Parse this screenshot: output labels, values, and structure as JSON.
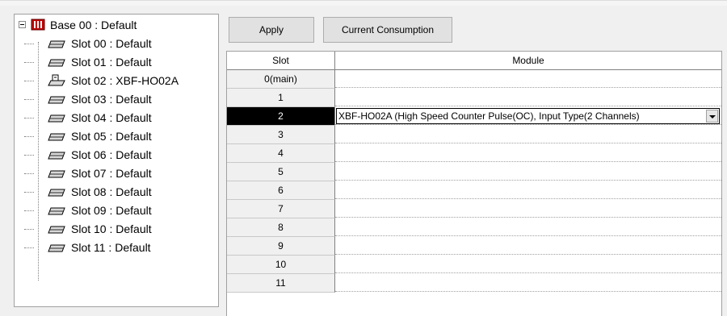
{
  "tree": {
    "base_label": "Base 00 : Default",
    "slots": [
      {
        "label": "Slot 00 : Default",
        "icon": "slot-module-icon"
      },
      {
        "label": "Slot 01 : Default",
        "icon": "slot-module-icon"
      },
      {
        "label": "Slot 02 : XBF-HO02A",
        "icon": "counter-module-icon"
      },
      {
        "label": "Slot 03 : Default",
        "icon": "slot-module-icon"
      },
      {
        "label": "Slot 04 : Default",
        "icon": "slot-module-icon"
      },
      {
        "label": "Slot 05 : Default",
        "icon": "slot-module-icon"
      },
      {
        "label": "Slot 06 : Default",
        "icon": "slot-module-icon"
      },
      {
        "label": "Slot 07 : Default",
        "icon": "slot-module-icon"
      },
      {
        "label": "Slot 08 : Default",
        "icon": "slot-module-icon"
      },
      {
        "label": "Slot 09 : Default",
        "icon": "slot-module-icon"
      },
      {
        "label": "Slot 10 : Default",
        "icon": "slot-module-icon"
      },
      {
        "label": "Slot 11 : Default",
        "icon": "slot-module-icon"
      }
    ]
  },
  "toolbar": {
    "apply_label": "Apply",
    "current_label": "Current Consumption"
  },
  "grid": {
    "columns": [
      "Slot",
      "Module"
    ],
    "selected_slot": "2",
    "rows": [
      {
        "slot": "0(main)",
        "module": ""
      },
      {
        "slot": "1",
        "module": ""
      },
      {
        "slot": "2",
        "module": "XBF-HO02A (High Speed Counter Pulse(OC), Input Type(2 Channels)"
      },
      {
        "slot": "3",
        "module": ""
      },
      {
        "slot": "4",
        "module": ""
      },
      {
        "slot": "5",
        "module": ""
      },
      {
        "slot": "6",
        "module": ""
      },
      {
        "slot": "7",
        "module": ""
      },
      {
        "slot": "8",
        "module": ""
      },
      {
        "slot": "9",
        "module": ""
      },
      {
        "slot": "10",
        "module": ""
      },
      {
        "slot": "11",
        "module": ""
      }
    ]
  },
  "colors": {
    "selected_row_bg": "#000000",
    "selected_row_fg": "#ffffff",
    "base_icon_color": "#b00000"
  }
}
